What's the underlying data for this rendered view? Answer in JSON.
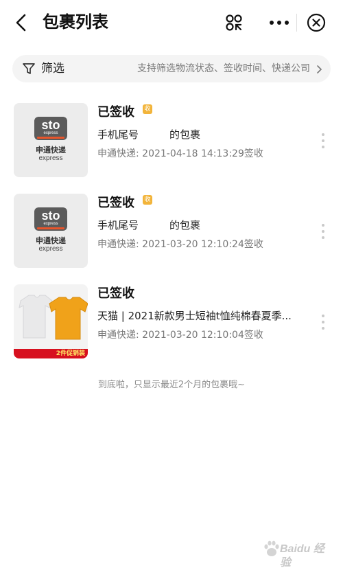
{
  "header": {
    "title": "包裹列表",
    "icons": [
      "back-arrow-icon",
      "scan-icon",
      "more-dots-icon",
      "close-circle-icon"
    ]
  },
  "filter": {
    "label": "筛选",
    "hint": "支持筛选物流状态、签收时间、快递公司",
    "icons": [
      "filter-funnel-icon",
      "chevron-right-icon"
    ]
  },
  "packages": [
    {
      "status": "已签收",
      "badge": "收",
      "description": "手机尾号　　　的包裹",
      "time": "申通快递: 2021-04-18 14:13:29签收",
      "thumb": {
        "type": "sto-logo",
        "logo_text": "sto",
        "logo_sub": "express",
        "name_cn": "申通快递",
        "name_en": "express"
      }
    },
    {
      "status": "已签收",
      "badge": "收",
      "description": "手机尾号　　　的包裹",
      "time": "申通快递: 2021-03-20 12:10:24签收",
      "thumb": {
        "type": "sto-logo",
        "logo_text": "sto",
        "logo_sub": "express",
        "name_cn": "申通快递",
        "name_en": "express"
      }
    },
    {
      "status": "已签收",
      "badge": "",
      "description": "天猫 | 2021新款男士短袖t恤纯棉春夏季...",
      "time": "申通快递: 2021-03-20 12:10:04签收",
      "thumb": {
        "type": "tshirt-photo",
        "promo": "2件促销装"
      }
    }
  ],
  "footer": {
    "note": "到底啦，只显示最近2个月的包裹哦~"
  },
  "watermark": {
    "text": "Baidu 经验"
  },
  "colors": {
    "badge": "#f2b43a",
    "filter_bg": "#f4f4f4",
    "promo_red": "#d7101f",
    "sto_orange": "#e8552b"
  }
}
